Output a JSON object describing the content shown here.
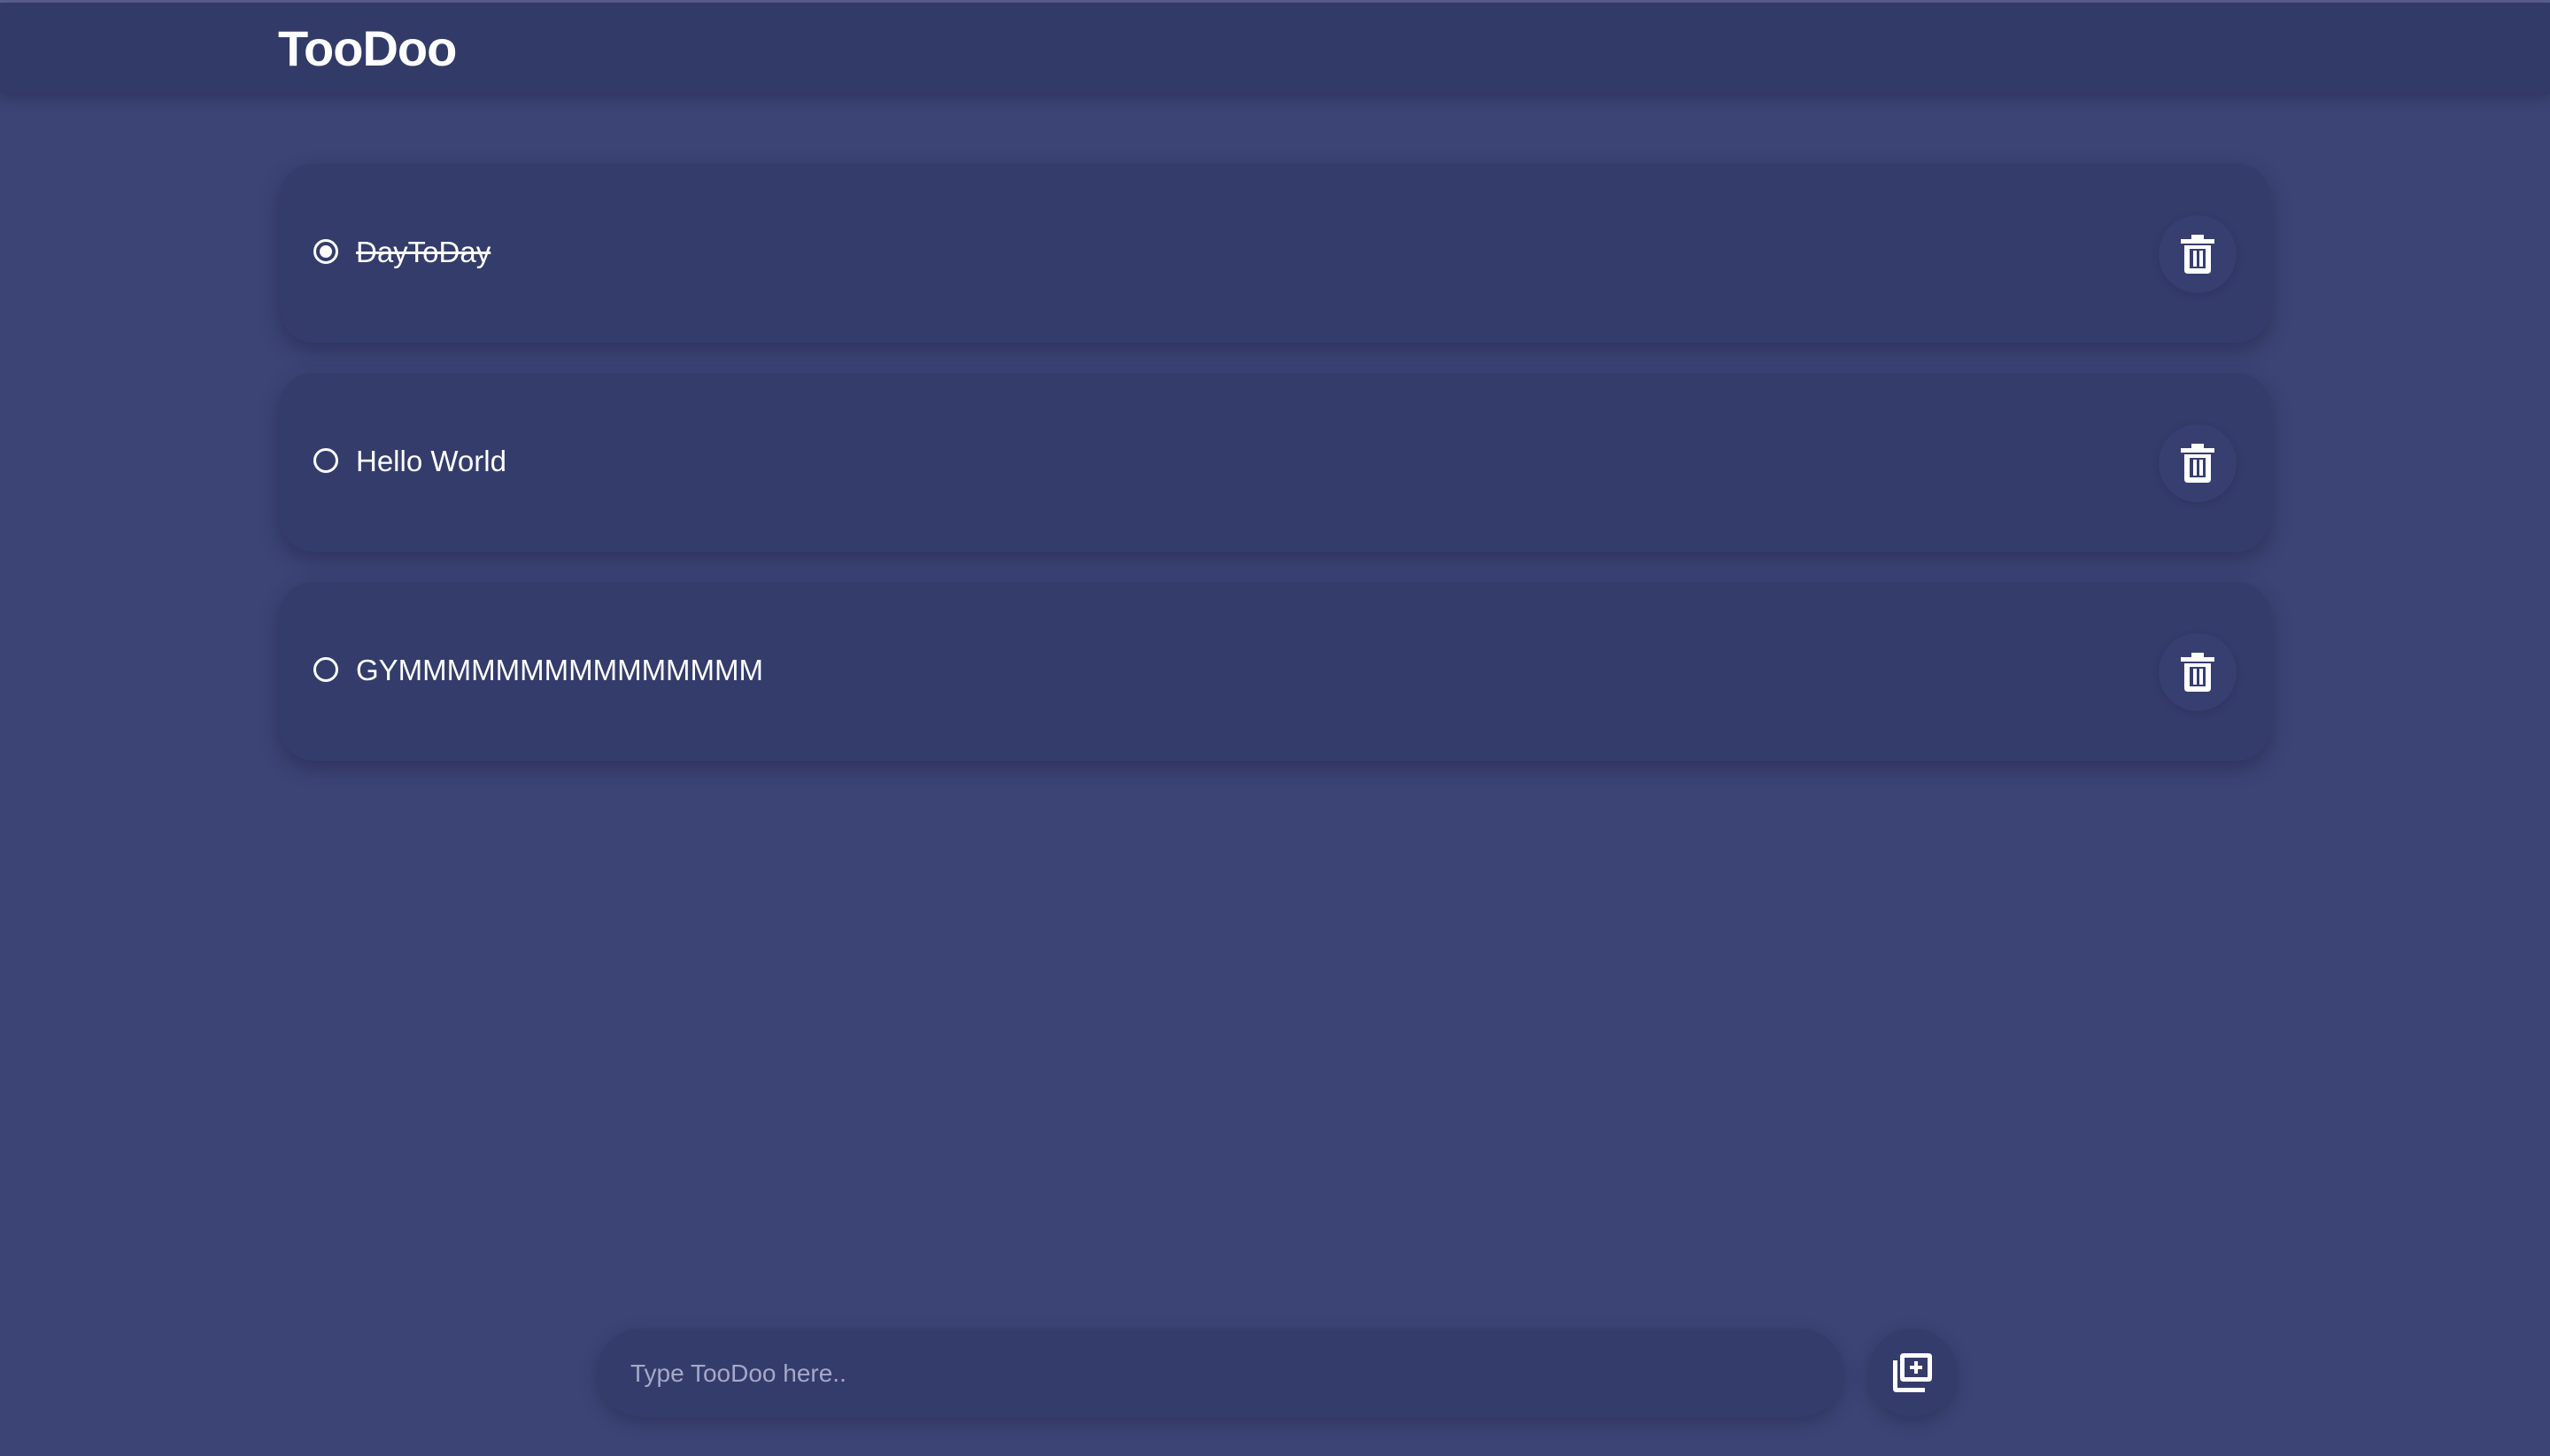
{
  "app": {
    "title": "TooDoo"
  },
  "todos": [
    {
      "text": "DayToDay",
      "completed": true
    },
    {
      "text": "Hello World",
      "completed": false
    },
    {
      "text": "GYMMMMMMMMMMMMMMM",
      "completed": false
    }
  ],
  "composer": {
    "placeholder": "Type TooDoo here..",
    "value": ""
  },
  "icons": {
    "delete": "trash-icon",
    "add": "add-box-icon"
  },
  "colors": {
    "background": "#3b4474",
    "header": "#323b68",
    "card": "#343c6b",
    "text": "#ffffff"
  }
}
